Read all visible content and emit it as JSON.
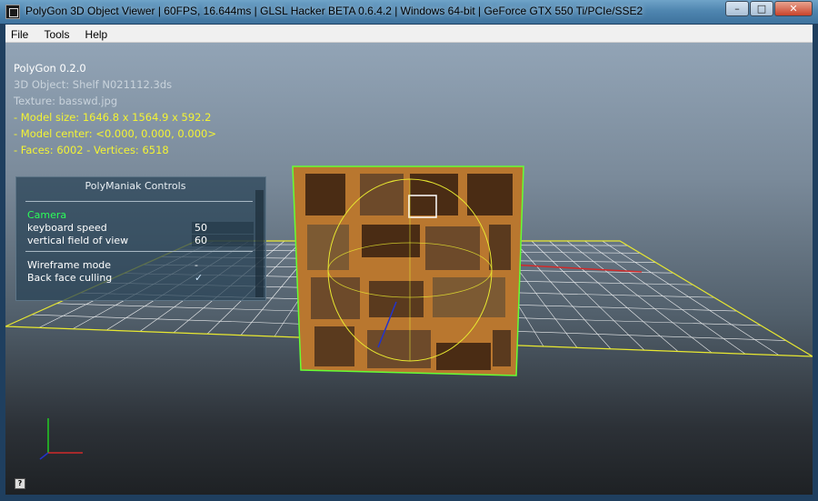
{
  "window": {
    "title": "PolyGon 3D Object Viewer | 60FPS, 16.644ms | GLSL Hacker BETA 0.6.4.2 | Windows 64-bit | GeForce GTX 550 Ti/PCIe/SSE2",
    "minimize_glyph": "–",
    "maximize_glyph": "□",
    "close_glyph": "✕"
  },
  "menu": {
    "items": [
      "File",
      "Tools",
      "Help"
    ]
  },
  "info": {
    "app_name": "PolyGon 0.2.0",
    "object": "3D Object: Shelf N021112.3ds",
    "texture": "Texture: basswd.jpg",
    "model_size": "- Model size:  1646.8 x 1564.9 x 592.2",
    "model_center": "- Model center:  <0.000, 0.000, 0.000>",
    "faces_vertices": "- Faces: 6002 - Vertices: 6518"
  },
  "controls": {
    "title": "PolyManiak Controls",
    "section_camera": "Camera",
    "keyboard_speed_label": "keyboard speed",
    "keyboard_speed_value": "50",
    "fov_label": "vertical field of view",
    "fov_value": "60",
    "wireframe_label": "Wireframe mode",
    "wireframe_value": "-",
    "backface_label": "Back face culling",
    "backface_value": "✓"
  },
  "help_glyph": "?",
  "colors": {
    "info_yellow": "#f3f334",
    "camera_green": "#2bff5a",
    "grid_white": "#ffffff",
    "grid_border_yellow": "#e8e830",
    "bbox_green": "#66ff33",
    "wood": "#c8893a"
  }
}
